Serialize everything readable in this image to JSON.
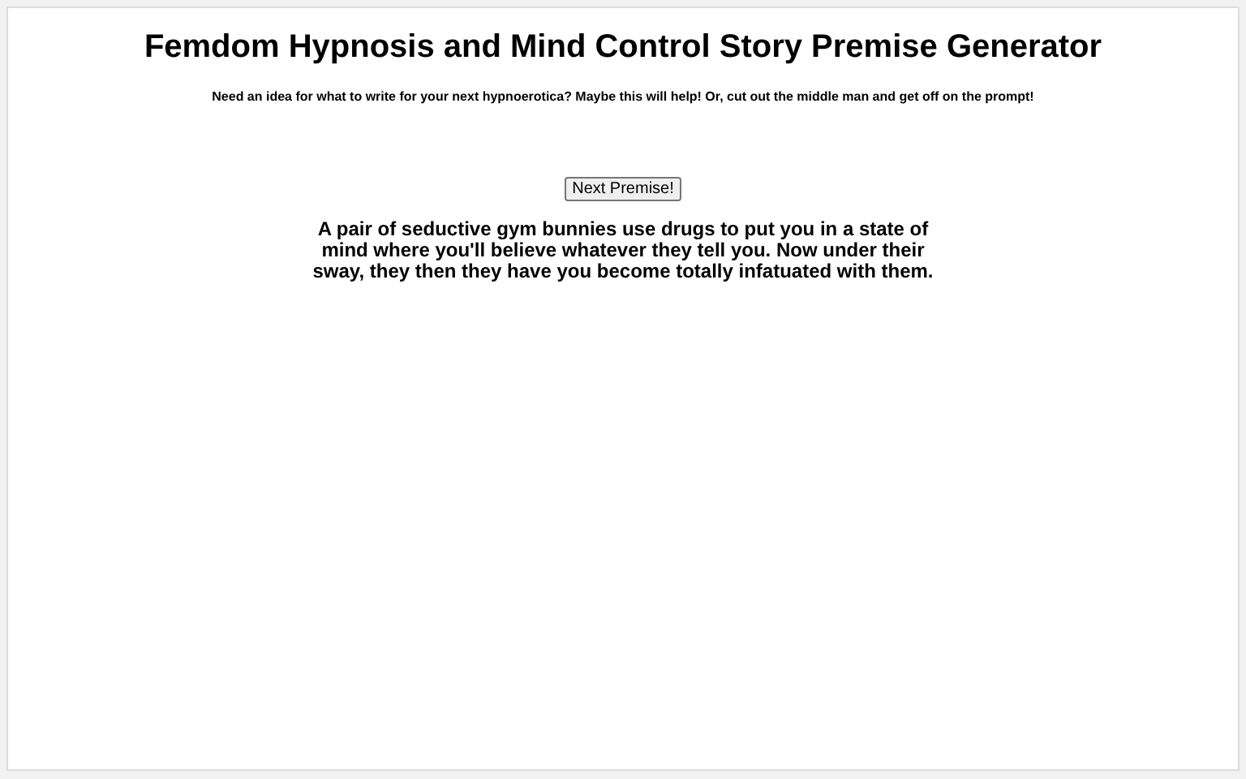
{
  "title": "Femdom Hypnosis and Mind Control Story Premise Generator",
  "subtitle": "Need an idea for what to write for your next hypnoerotica? Maybe this will help! Or, cut out the middle man and get off on the prompt!",
  "button": "Next Premise!",
  "premise": "A pair of seductive gym bunnies use drugs to put you in a state of mind where you'll believe whatever they tell you. Now under their sway, they then they have you become totally infatuated with them."
}
